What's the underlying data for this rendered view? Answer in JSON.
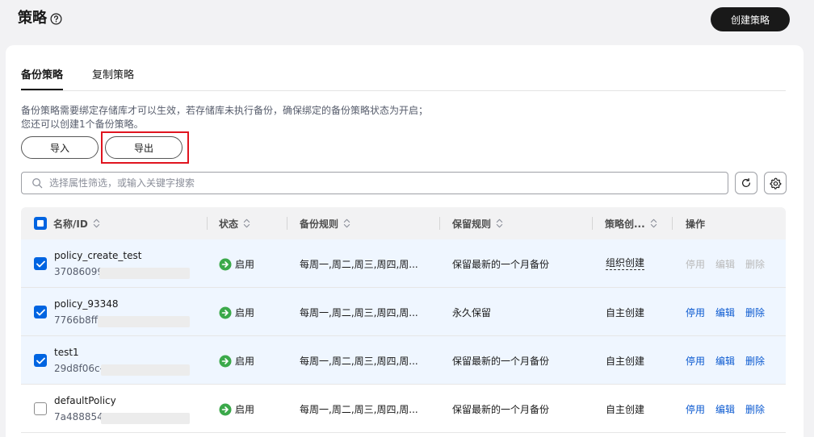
{
  "header": {
    "title": "策略",
    "create_label": "创建策略"
  },
  "tabs": [
    {
      "label": "备份策略"
    },
    {
      "label": "复制策略"
    }
  ],
  "description": {
    "line1": "备份策略需要绑定存储库才可以生效，若存储库未执行备份，确保绑定的备份策略状态为开启；",
    "line2": "您还可以创建1个备份策略。"
  },
  "actions": {
    "import_label": "导入",
    "export_label": "导出"
  },
  "search": {
    "placeholder": "选择属性筛选，或输入关键字搜索"
  },
  "table": {
    "columns": {
      "name": "名称/ID",
      "status": "状态",
      "backup_rule": "备份规则",
      "retention": "保留规则",
      "created_by": "策略创...",
      "ops": "操作"
    },
    "rows": [
      {
        "name": "policy_create_test",
        "id": "37086099-",
        "status": "启用",
        "backup_rule": "每周一,周二,周三,周四,周...",
        "retention": "保留最新的一个月备份",
        "created_by": "组织创建",
        "op_stop": "停用",
        "op_edit": "编辑",
        "op_delete": "删除"
      },
      {
        "name": "policy_93348",
        "id": "7766b8ff-",
        "status": "启用",
        "backup_rule": "每周一,周二,周三,周四,周...",
        "retention": "永久保留",
        "created_by": "自主创建",
        "op_stop": "停用",
        "op_edit": "编辑",
        "op_delete": "删除"
      },
      {
        "name": "test1",
        "id": "29d8f06c-",
        "status": "启用",
        "backup_rule": "每周一,周二,周三,周四,周...",
        "retention": "保留最新的一个月备份",
        "created_by": "自主创建",
        "op_stop": "停用",
        "op_edit": "编辑",
        "op_delete": "删除"
      },
      {
        "name": "defaultPolicy",
        "id": "7a488854-",
        "status": "启用",
        "backup_rule": "每周一,周二,周三,周四,周...",
        "retention": "保留最新的一个月备份",
        "created_by": "自主创建",
        "op_stop": "停用",
        "op_edit": "编辑",
        "op_delete": "删除"
      }
    ]
  },
  "colors": {
    "primary": "#0064e1",
    "link": "#0a59d0",
    "status_green": "#3ba94a",
    "highlight": "#e0141f"
  }
}
